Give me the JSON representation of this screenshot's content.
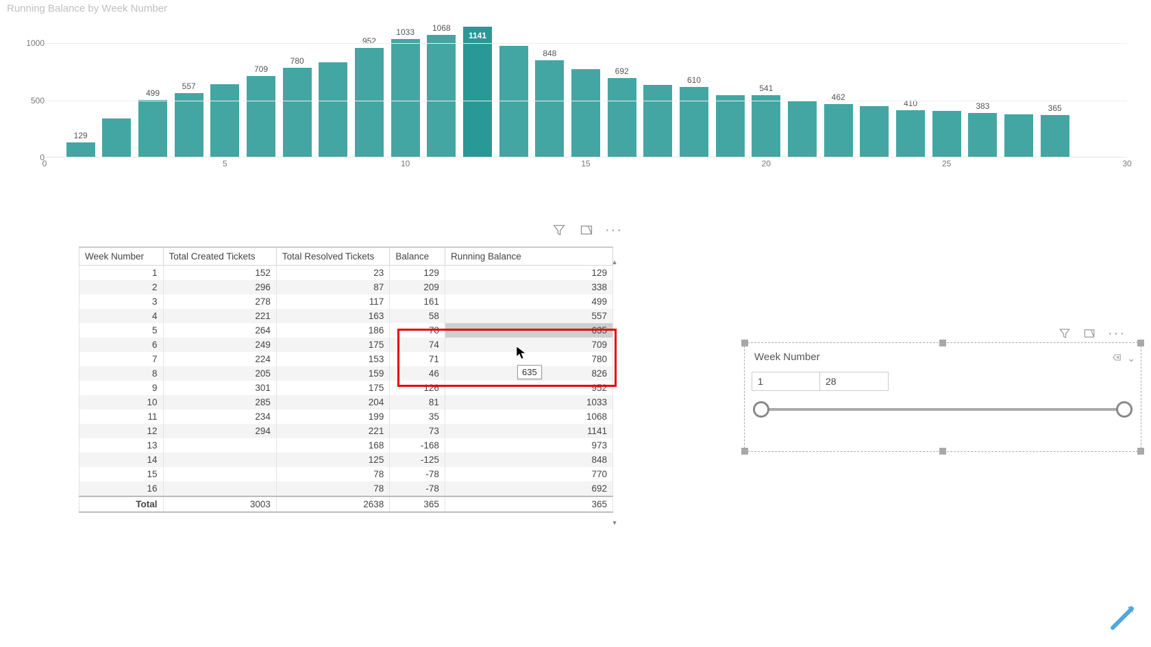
{
  "chart_data": {
    "type": "bar",
    "title": "Running Balance by Week Number",
    "xlabel": "Week Number",
    "ylabel": "",
    "ylim": [
      0,
      1200
    ],
    "x_ticks": [
      0,
      5,
      10,
      15,
      20,
      25,
      30
    ],
    "y_ticks": [
      0,
      500,
      1000
    ],
    "highlight_index": 11,
    "categories": [
      1,
      2,
      3,
      4,
      5,
      6,
      7,
      8,
      9,
      10,
      11,
      12,
      13,
      14,
      15,
      16,
      17,
      18,
      19,
      20,
      21,
      22,
      23,
      24,
      25,
      26,
      27,
      28
    ],
    "values": [
      129,
      338,
      499,
      557,
      635,
      709,
      780,
      826,
      952,
      1033,
      1068,
      1141,
      973,
      848,
      770,
      692,
      633,
      610,
      539,
      541,
      489,
      462,
      445,
      410,
      400,
      383,
      375,
      365
    ],
    "visible_labels": {
      "0": 129,
      "2": 499,
      "3": 557,
      "5": 709,
      "6": 780,
      "8": 952,
      "9": 1033,
      "10": 1068,
      "11": 1141,
      "13": 848,
      "15": 692,
      "17": 610,
      "19": 541,
      "21": 462,
      "23": 410,
      "25": 383,
      "27": 365
    }
  },
  "table": {
    "headers": [
      "Week Number",
      "Total Created Tickets",
      "Total Resolved Tickets",
      "Balance",
      "Running Balance"
    ],
    "rows": [
      {
        "week": 1,
        "created": 152,
        "resolved": 23,
        "balance": 129,
        "running": 129
      },
      {
        "week": 2,
        "created": 296,
        "resolved": 87,
        "balance": 209,
        "running": 338
      },
      {
        "week": 3,
        "created": 278,
        "resolved": 117,
        "balance": 161,
        "running": 499
      },
      {
        "week": 4,
        "created": 221,
        "resolved": 163,
        "balance": 58,
        "running": 557
      },
      {
        "week": 5,
        "created": 264,
        "resolved": 186,
        "balance": 78,
        "running": 635
      },
      {
        "week": 6,
        "created": 249,
        "resolved": 175,
        "balance": 74,
        "running": 709
      },
      {
        "week": 7,
        "created": 224,
        "resolved": 153,
        "balance": 71,
        "running": 780
      },
      {
        "week": 8,
        "created": 205,
        "resolved": 159,
        "balance": 46,
        "running": 826
      },
      {
        "week": 9,
        "created": 301,
        "resolved": 175,
        "balance": 126,
        "running": 952
      },
      {
        "week": 10,
        "created": 285,
        "resolved": 204,
        "balance": 81,
        "running": 1033
      },
      {
        "week": 11,
        "created": 234,
        "resolved": 199,
        "balance": 35,
        "running": 1068
      },
      {
        "week": 12,
        "created": 294,
        "resolved": 221,
        "balance": 73,
        "running": 1141
      },
      {
        "week": 13,
        "created": null,
        "resolved": 168,
        "balance": -168,
        "running": 973
      },
      {
        "week": 14,
        "created": null,
        "resolved": 125,
        "balance": -125,
        "running": 848
      },
      {
        "week": 15,
        "created": null,
        "resolved": 78,
        "balance": -78,
        "running": 770
      },
      {
        "week": 16,
        "created": null,
        "resolved": 78,
        "balance": -78,
        "running": 692
      }
    ],
    "total": {
      "label": "Total",
      "created": 3003,
      "resolved": 2638,
      "balance": 365,
      "running": 365
    }
  },
  "tooltip_value": "635",
  "slicer": {
    "title": "Week Number",
    "min": "1",
    "max": "28"
  }
}
